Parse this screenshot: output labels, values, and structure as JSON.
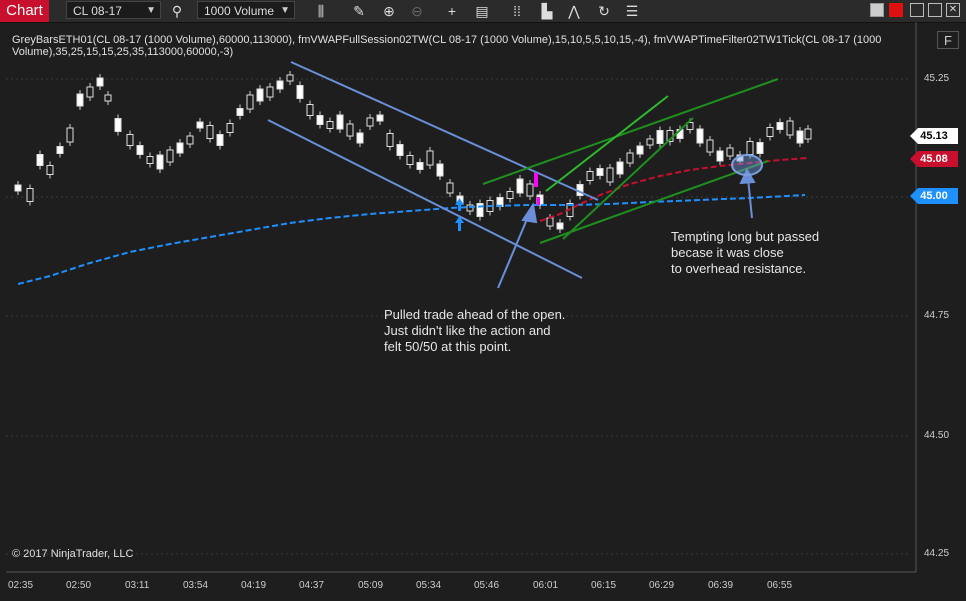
{
  "toolbar": {
    "chart_tab": "Chart",
    "instrument": "CL 08-17",
    "interval": "1000 Volume"
  },
  "indicators_text": "GreyBarsETH01(CL 08-17 (1000 Volume),60000,113000), fmVWAPFullSession02TW(CL 08-17 (1000 Volume),15,10,5,5,10,15,-4), fmVWAPTimeFilter02TW1Tick(CL 08-17 (1000 Volume),35,25,15,15,25,35,113000,60000,-3)",
  "panel_badge": "F",
  "copyright": "© 2017 NinjaTrader, LLC",
  "y_axis": {
    "ticks": [
      "45.25",
      "45.00",
      "44.75",
      "44.50",
      "44.25"
    ]
  },
  "x_axis": {
    "ticks": [
      "02:35",
      "02:50",
      "03:11",
      "03:54",
      "04:19",
      "04:37",
      "05:09",
      "05:34",
      "05:46",
      "06:01",
      "06:15",
      "06:29",
      "06:39",
      "06:55"
    ]
  },
  "price_badges": [
    {
      "label": "45.13",
      "bg": "#ffffff",
      "fg": "#000000"
    },
    {
      "label": "45.08",
      "bg": "#c8102e",
      "fg": "#ffffff"
    },
    {
      "label": "45.00",
      "bg": "#1e90ff",
      "fg": "#ffffff"
    }
  ],
  "annotations": {
    "pulled_line1": "Pulled trade ahead of the open.",
    "pulled_line2": "Just didn't like the action and",
    "pulled_line3": "felt 50/50 at this point.",
    "tempting_line1": "Tempting long but passed",
    "tempting_line2": "becase it was close",
    "tempting_line3": "to overhead resistance."
  },
  "colors": {
    "vwap_full": "#1e90ff",
    "vwap_filter": "#c8102e",
    "channel": "#6a8fd8",
    "trend_green": "#1f8f1f",
    "candle": "#ffffff",
    "up_arrow": "#1e90ff",
    "signal_magenta": "#ff00ff"
  }
}
